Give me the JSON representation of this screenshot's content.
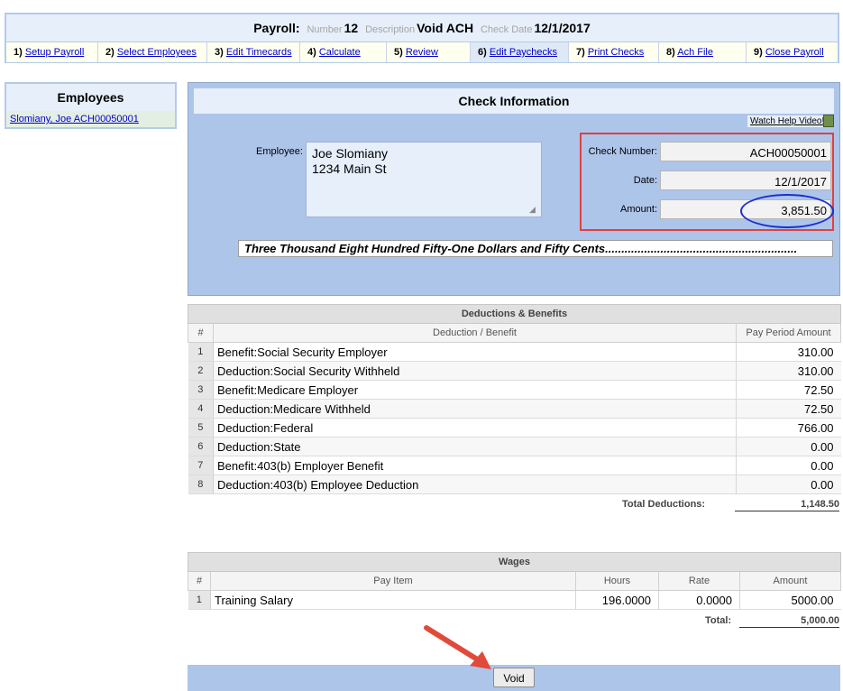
{
  "header": {
    "title_label": "Payroll:",
    "number_label": "Number",
    "number_value": "12",
    "description_label": "Description",
    "description_value": "Void ACH",
    "check_date_label": "Check Date",
    "check_date_value": "12/1/2017",
    "steps": [
      {
        "num": "1)",
        "label": "Setup Payroll"
      },
      {
        "num": "2)",
        "label": "Select Employees"
      },
      {
        "num": "3)",
        "label": "Edit Timecards"
      },
      {
        "num": "4)",
        "label": "Calculate"
      },
      {
        "num": "5)",
        "label": "Review"
      },
      {
        "num": "6)",
        "label": "Edit Paychecks"
      },
      {
        "num": "7)",
        "label": "Print Checks"
      },
      {
        "num": "8)",
        "label": "Ach File"
      },
      {
        "num": "9)",
        "label": "Close Payroll"
      }
    ]
  },
  "employees": {
    "title": "Employees",
    "selected": "Slomiany, Joe ACH00050001"
  },
  "check": {
    "title": "Check Information",
    "help_link": "Watch Help Video!",
    "employee_label": "Employee:",
    "employee_text": "Joe Slomiany\n1234 Main St",
    "check_number_label": "Check Number:",
    "check_number": "ACH00050001",
    "date_label": "Date:",
    "date": "12/1/2017",
    "amount_label": "Amount:",
    "amount": "3,851.50",
    "amount_words": "Three Thousand Eight Hundred Fifty-One Dollars and Fifty Cents..........................................................."
  },
  "deductions": {
    "title": "Deductions & Benefits",
    "col_index": "#",
    "col_name": "Deduction / Benefit",
    "col_amount": "Pay Period Amount",
    "rows": [
      {
        "idx": "1",
        "name": "Benefit:Social Security Employer",
        "amount": "310.00"
      },
      {
        "idx": "2",
        "name": "Deduction:Social Security Withheld",
        "amount": "310.00"
      },
      {
        "idx": "3",
        "name": "Benefit:Medicare Employer",
        "amount": "72.50"
      },
      {
        "idx": "4",
        "name": "Deduction:Medicare Withheld",
        "amount": "72.50"
      },
      {
        "idx": "5",
        "name": "Deduction:Federal",
        "amount": "766.00"
      },
      {
        "idx": "6",
        "name": "Deduction:State",
        "amount": "0.00"
      },
      {
        "idx": "7",
        "name": "Benefit:403(b) Employer Benefit",
        "amount": "0.00"
      },
      {
        "idx": "8",
        "name": "Deduction:403(b) Employee Deduction",
        "amount": "0.00"
      }
    ],
    "total_label": "Total Deductions:",
    "total_value": "1,148.50"
  },
  "wages": {
    "title": "Wages",
    "col_index": "#",
    "col_item": "Pay Item",
    "col_hours": "Hours",
    "col_rate": "Rate",
    "col_amount": "Amount",
    "rows": [
      {
        "idx": "1",
        "item": "Training Salary",
        "hours": "196.0000",
        "rate": "0.0000",
        "amount": "5000.00"
      }
    ],
    "total_label": "Total:",
    "total_value": "5,000.00"
  },
  "footer": {
    "void_label": "Void"
  },
  "colors": {
    "panel_blue": "#aec5ea",
    "highlight_red": "#e04040",
    "highlight_blue": "#1a2fd1",
    "arrow": "#e04a3a"
  }
}
